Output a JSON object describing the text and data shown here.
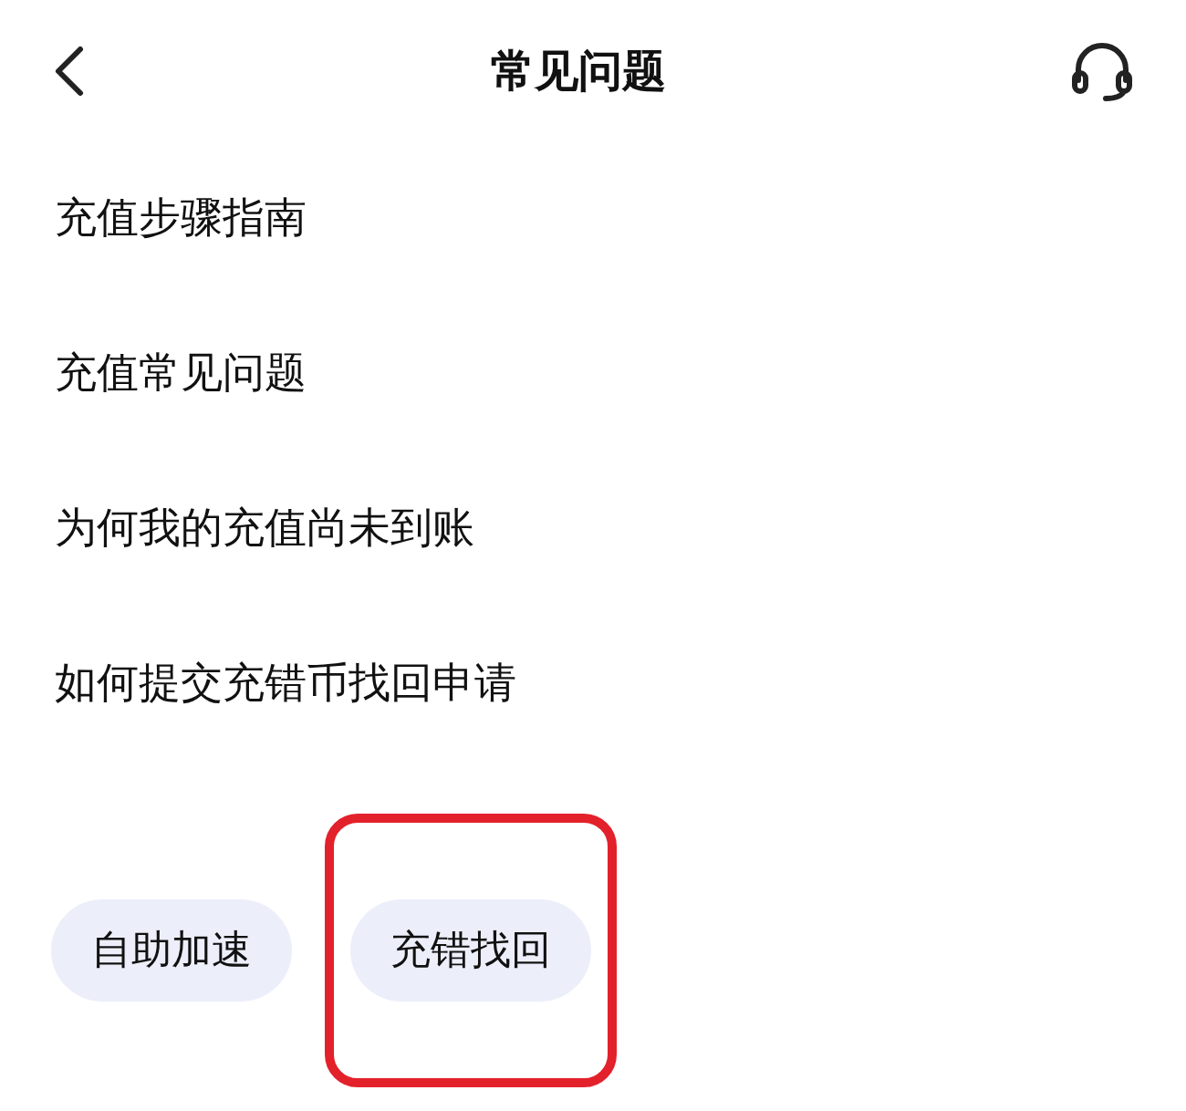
{
  "header": {
    "title": "常见问题"
  },
  "questions": [
    "充值步骤指南",
    "充值常见问题",
    "为何我的充值尚未到账",
    "如何提交充错币找回申请"
  ],
  "actions": [
    {
      "label": "自助加速",
      "highlighted": false
    },
    {
      "label": "充错找回",
      "highlighted": true
    }
  ]
}
